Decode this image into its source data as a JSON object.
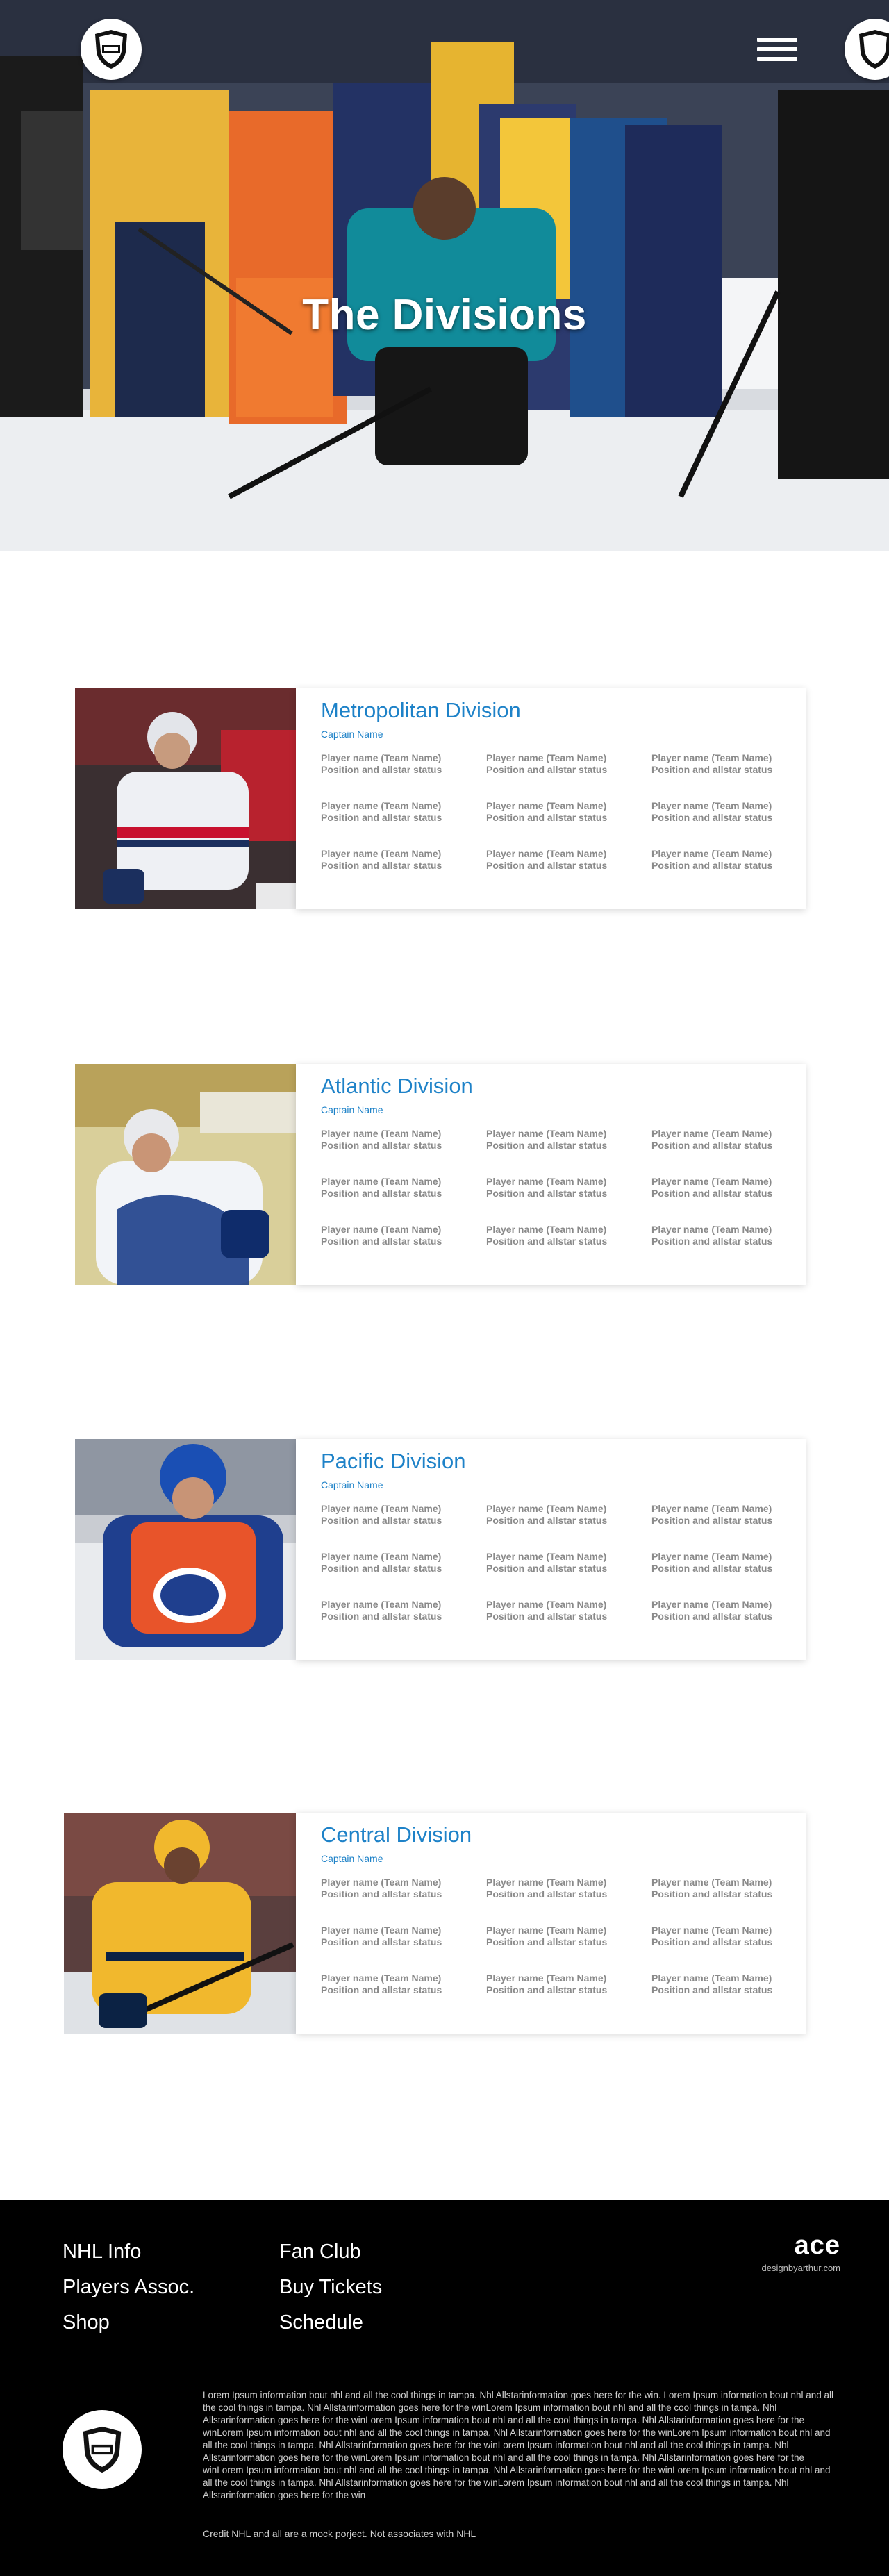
{
  "hero": {
    "title": "The Divisions"
  },
  "nav": {
    "logo_icon": "nhl-shield-icon",
    "menu_icon": "hamburger-menu-icon"
  },
  "divisions": [
    {
      "title": "Metropolitan Division",
      "captain": "Captain Name",
      "photo_icon": "player-photo-capitals",
      "players": [
        {
          "name": "Player name (Team Name)",
          "status": "Position and allstar status"
        },
        {
          "name": "Player name (Team Name)",
          "status": "Position and allstar status"
        },
        {
          "name": "Player name (Team Name)",
          "status": "Position and allstar status"
        },
        {
          "name": "Player name (Team Name)",
          "status": "Position and allstar status"
        },
        {
          "name": "Player name (Team Name)",
          "status": "Position and allstar status"
        },
        {
          "name": "Player name (Team Name)",
          "status": "Position and allstar status"
        },
        {
          "name": "Player name (Team Name)",
          "status": "Position and allstar status"
        },
        {
          "name": "Player name (Team Name)",
          "status": "Position and allstar status"
        },
        {
          "name": "Player name (Team Name)",
          "status": "Position and allstar status"
        }
      ]
    },
    {
      "title": "Atlantic Division",
      "captain": "Captain Name",
      "photo_icon": "player-photo-lightning",
      "players": [
        {
          "name": "Player name (Team Name)",
          "status": "Position and allstar status"
        },
        {
          "name": "Player name (Team Name)",
          "status": "Position and allstar status"
        },
        {
          "name": "Player name (Team Name)",
          "status": "Position and allstar status"
        },
        {
          "name": "Player name (Team Name)",
          "status": "Position and allstar status"
        },
        {
          "name": "Player name (Team Name)",
          "status": "Position and allstar status"
        },
        {
          "name": "Player name (Team Name)",
          "status": "Position and allstar status"
        },
        {
          "name": "Player name (Team Name)",
          "status": "Position and allstar status"
        },
        {
          "name": "Player name (Team Name)",
          "status": "Position and allstar status"
        },
        {
          "name": "Player name (Team Name)",
          "status": "Position and allstar status"
        }
      ]
    },
    {
      "title": "Pacific Division",
      "captain": "Captain Name",
      "photo_icon": "player-photo-oilers",
      "players": [
        {
          "name": "Player name (Team Name)",
          "status": "Position and allstar status"
        },
        {
          "name": "Player name (Team Name)",
          "status": "Position and allstar status"
        },
        {
          "name": "Player name (Team Name)",
          "status": "Position and allstar status"
        },
        {
          "name": "Player name (Team Name)",
          "status": "Position and allstar status"
        },
        {
          "name": "Player name (Team Name)",
          "status": "Position and allstar status"
        },
        {
          "name": "Player name (Team Name)",
          "status": "Position and allstar status"
        },
        {
          "name": "Player name (Team Name)",
          "status": "Position and allstar status"
        },
        {
          "name": "Player name (Team Name)",
          "status": "Position and allstar status"
        },
        {
          "name": "Player name (Team Name)",
          "status": "Position and allstar status"
        }
      ]
    },
    {
      "title": "Central Division",
      "captain": "Captain Name",
      "photo_icon": "player-photo-predators",
      "players": [
        {
          "name": "Player name (Team Name)",
          "status": "Position and allstar status"
        },
        {
          "name": "Player name (Team Name)",
          "status": "Position and allstar status"
        },
        {
          "name": "Player name (Team Name)",
          "status": "Position and allstar status"
        },
        {
          "name": "Player name (Team Name)",
          "status": "Position and allstar status"
        },
        {
          "name": "Player name (Team Name)",
          "status": "Position and allstar status"
        },
        {
          "name": "Player name (Team Name)",
          "status": "Position and allstar status"
        },
        {
          "name": "Player name (Team Name)",
          "status": "Position and allstar status"
        },
        {
          "name": "Player name (Team Name)",
          "status": "Position and allstar status"
        },
        {
          "name": "Player name (Team Name)",
          "status": "Position and allstar status"
        }
      ]
    }
  ],
  "footer": {
    "links_col1": [
      "NHL Info",
      "Players Assoc.",
      "Shop"
    ],
    "links_col2": [
      "Fan Club",
      "Buy Tickets",
      "Schedule"
    ],
    "brand": "ace",
    "brand_sub": "designbyarthur.com",
    "logo_icon": "nhl-shield-icon",
    "body": "Lorem Ipsum information bout nhl and all the cool things in tampa. Nhl  Allstarinformation goes here for the win. Lorem Ipsum information bout nhl and all the cool things in tampa. Nhl  Allstarinformation goes here for the winLorem Ipsum information bout nhl and all the cool things in tampa. Nhl  Allstarinformation goes here for the winLorem Ipsum information bout nhl and all the cool things in tampa. Nhl  Allstarinformation goes here for the winLorem Ipsum information bout nhl and all the cool things in tampa. Nhl  Allstarinformation goes here for the winLorem Ipsum information bout nhl and all the cool things in tampa. Nhl  Allstarinformation goes here for the winLorem Ipsum information bout nhl and all the cool things in tampa. Nhl  Allstarinformation goes here for the winLorem Ipsum information bout nhl and all the cool things in tampa. Nhl  Allstarinformation goes here for the winLorem Ipsum information bout nhl and all the cool things in tampa. Nhl  Allstarinformation goes here for the winLorem Ipsum information bout nhl and all the cool things in tampa. Nhl  Allstarinformation goes here for the winLorem Ipsum information bout nhl and all the cool things in tampa. Nhl  Allstarinformation goes here for the win",
    "credit": "Credit NHL and all are a mock porject. Not associates with NHL"
  },
  "colors": {
    "accent": "#1e82c8",
    "player_text": "#8a8a8a",
    "footer_bg": "#000000"
  }
}
